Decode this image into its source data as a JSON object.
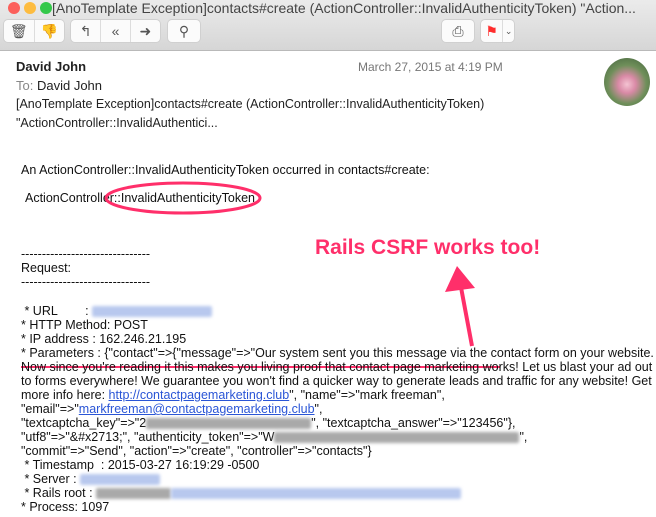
{
  "window": {
    "title": "[AnoTemplate Exception]contacts#create (ActionController::InvalidAuthenticityToken) \"Action..."
  },
  "toolbar": {
    "delete": "trash-icon",
    "junk": "thumbs-down-icon",
    "reply": "reply-icon",
    "reply_all": "reply-all-icon",
    "forward": "forward-icon",
    "search": "search-icon",
    "print": "print-icon",
    "flag": "flag-icon",
    "flag_color": "#ff2d2d"
  },
  "header": {
    "from": "David John",
    "date": "March 27, 2015 at 4:19 PM",
    "to_label": "To:",
    "to": "David John",
    "subject_line1": "[AnoTemplate Exception]contacts#create (ActionController::InvalidAuthenticityToken)",
    "subject_line2": "\"ActionController::InvalidAuthentici..."
  },
  "body": {
    "intro": "An ActionController::InvalidAuthenticityToken occurred in contacts#create:",
    "error": "ActionController::InvalidAuthenticityToken",
    "dashes": "-------------------------------",
    "request": "Request:",
    "url": " * URL        : ",
    "method": " * HTTP Method: POST",
    "ip": " * IP address : 162.246.21.195",
    "params1": " * Parameters : {\"contact\"=>{\"message\"=>\"Our system sent you this message via the contact form on your website.",
    "params2a": "Now since you're reading it this makes you living proof that contact page marketing works!",
    "params2b": " Let us blast your ad out",
    "params3": "to forms everywhere! We guarantee you won't find a quicker way to generate leads and traffic for any website! Get",
    "params4a": "more info here: ",
    "link1": "http://contactpagemarketing.club",
    "params4b": "\", \"name\"=>\"mark freeman\",",
    "params5a": "\"email\"=>\"",
    "link2": "markfreeman@contactpagemarketing.club",
    "params5b": "\",",
    "params6a": "\"textcaptcha_key\"=>\"2",
    "params6b": "\", \"textcaptcha_answer\"=>\"123456\"},",
    "params7a": "\"utf8\"=>\"&#x2713;\", \"authenticity_token\"=>\"W",
    "params7b": "\",",
    "params8": "\"commit\"=>\"Send\", \"action\"=>\"create\", \"controller\"=>\"contacts\"}",
    "timestamp": " * Timestamp  : 2015-03-27 16:19:29 -0500",
    "server": " * Server : ",
    "rails_root": " * Rails root : ",
    "process": " * Process: 1097"
  },
  "annotation": {
    "text": "Rails CSRF works too!",
    "color": "#ff2f6a"
  }
}
